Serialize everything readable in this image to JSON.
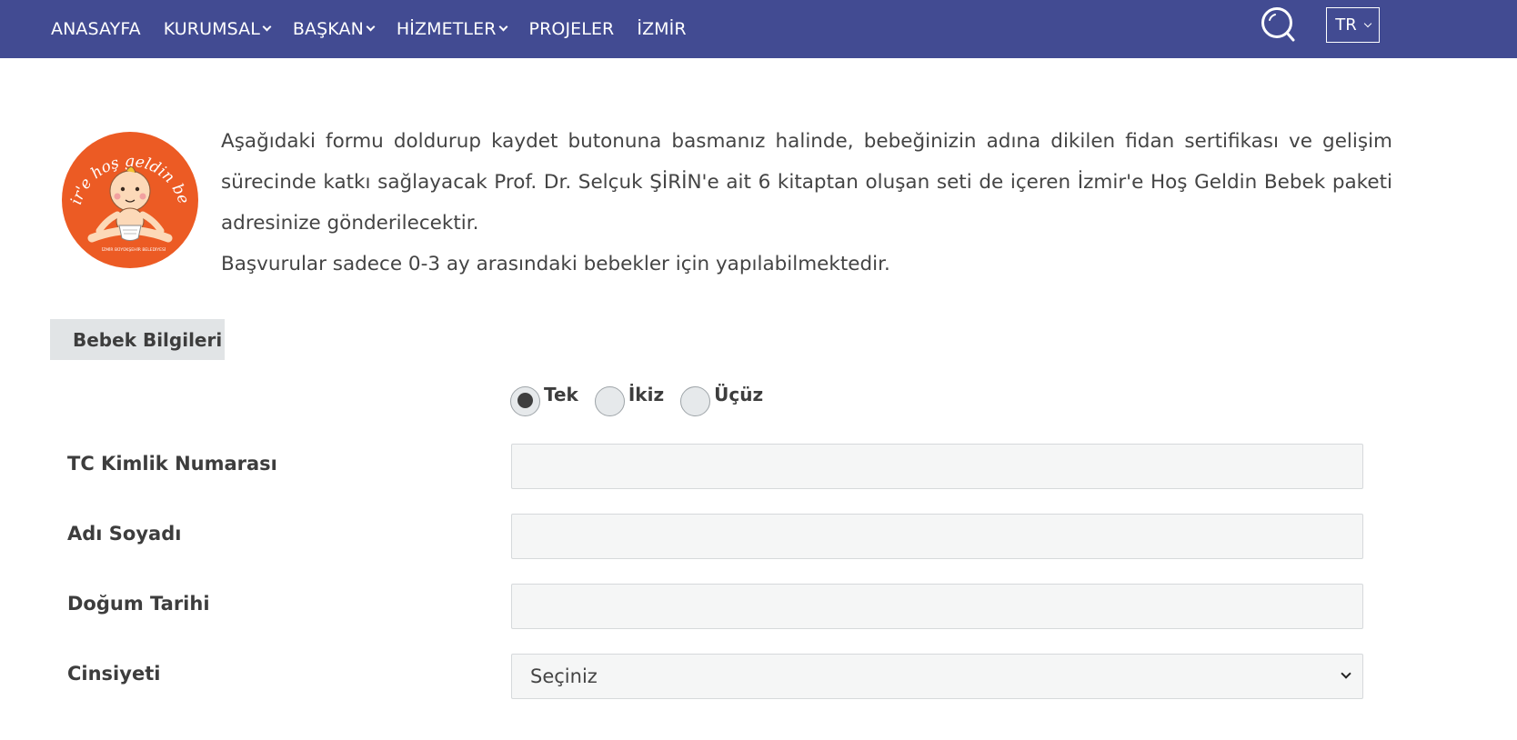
{
  "header": {
    "nav": [
      {
        "label": "ANASAYFA",
        "has_dropdown": false
      },
      {
        "label": "KURUMSAL",
        "has_dropdown": true
      },
      {
        "label": "BAŞKAN",
        "has_dropdown": true
      },
      {
        "label": "HİZMETLER",
        "has_dropdown": true
      },
      {
        "label": "PROJELER",
        "has_dropdown": false
      },
      {
        "label": "İZMİR",
        "has_dropdown": false
      }
    ],
    "search_icon": "search-icon",
    "language": "TR"
  },
  "logo": {
    "text": "izmir'e hoş geldin bebek",
    "footer_text": "İZMİR BÜYÜKŞEHİR BELEDİYESİ"
  },
  "intro": {
    "paragraph": "Aşağıdaki formu doldurup kaydet butonuna basmanız halinde, bebeğinizin adına dikilen fidan sertifikası ve gelişim sürecinde katkı sağlayacak Prof. Dr. Selçuk ŞİRİN'e ait 6 kitaptan oluşan seti de içeren İzmir'e Hoş Geldin Bebek paketi adresinize gönderilecektir.",
    "note": "Başvurular sadece 0-3 ay arasındaki bebekler için yapılabilmektedir."
  },
  "form": {
    "section_title": "Bebek Bilgileri",
    "birth_type": {
      "options": [
        "Tek",
        "İkiz",
        "Üçüz"
      ],
      "selected": "Tek"
    },
    "fields": {
      "tc_label": "TC Kimlik Numarası",
      "tc_value": "",
      "name_label": "Adı Soyadı",
      "name_value": "",
      "birth_label": "Doğum Tarihi",
      "birth_value": "",
      "gender_label": "Cinsiyeti",
      "gender_selected": "Seçiniz"
    }
  },
  "colors": {
    "nav_background": "#424b92",
    "logo_orange": "#ec5b24",
    "section_tab_background": "#e1e4e6",
    "input_background": "#f5f6f6"
  }
}
